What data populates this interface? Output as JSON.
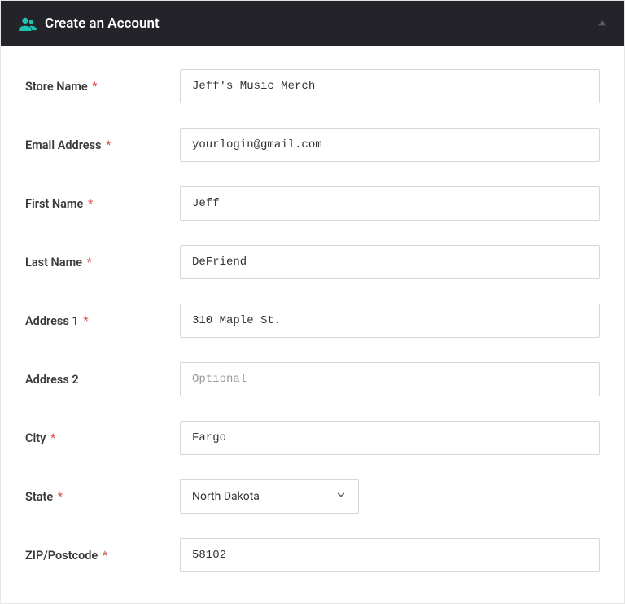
{
  "header": {
    "title": "Create an Account"
  },
  "fields": {
    "storeName": {
      "label": "Store Name",
      "required": true,
      "value": "Jeff's Music Merch"
    },
    "email": {
      "label": "Email Address",
      "required": true,
      "value": "yourlogin@gmail.com"
    },
    "firstName": {
      "label": "First Name",
      "required": true,
      "value": "Jeff"
    },
    "lastName": {
      "label": "Last Name",
      "required": true,
      "value": "DeFriend"
    },
    "address1": {
      "label": "Address 1",
      "required": true,
      "value": "310 Maple St."
    },
    "address2": {
      "label": "Address 2",
      "required": false,
      "value": "",
      "placeholder": "Optional"
    },
    "city": {
      "label": "City",
      "required": true,
      "value": "Fargo"
    },
    "state": {
      "label": "State",
      "required": true,
      "value": "North Dakota"
    },
    "zip": {
      "label": "ZIP/Postcode",
      "required": true,
      "value": "58102"
    }
  },
  "requiredMark": "*"
}
